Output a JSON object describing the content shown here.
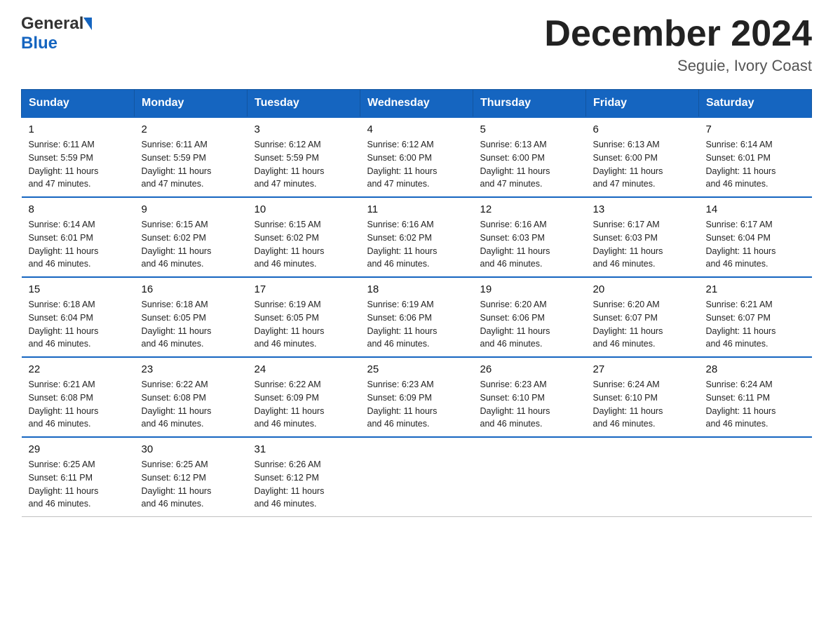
{
  "header": {
    "logo_line1": "General",
    "logo_line2": "Blue",
    "main_title": "December 2024",
    "subtitle": "Seguie, Ivory Coast"
  },
  "days_of_week": [
    "Sunday",
    "Monday",
    "Tuesday",
    "Wednesday",
    "Thursday",
    "Friday",
    "Saturday"
  ],
  "weeks": [
    [
      {
        "day": "1",
        "sunrise": "6:11 AM",
        "sunset": "5:59 PM",
        "daylight": "11 hours and 47 minutes."
      },
      {
        "day": "2",
        "sunrise": "6:11 AM",
        "sunset": "5:59 PM",
        "daylight": "11 hours and 47 minutes."
      },
      {
        "day": "3",
        "sunrise": "6:12 AM",
        "sunset": "5:59 PM",
        "daylight": "11 hours and 47 minutes."
      },
      {
        "day": "4",
        "sunrise": "6:12 AM",
        "sunset": "6:00 PM",
        "daylight": "11 hours and 47 minutes."
      },
      {
        "day": "5",
        "sunrise": "6:13 AM",
        "sunset": "6:00 PM",
        "daylight": "11 hours and 47 minutes."
      },
      {
        "day": "6",
        "sunrise": "6:13 AM",
        "sunset": "6:00 PM",
        "daylight": "11 hours and 47 minutes."
      },
      {
        "day": "7",
        "sunrise": "6:14 AM",
        "sunset": "6:01 PM",
        "daylight": "11 hours and 46 minutes."
      }
    ],
    [
      {
        "day": "8",
        "sunrise": "6:14 AM",
        "sunset": "6:01 PM",
        "daylight": "11 hours and 46 minutes."
      },
      {
        "day": "9",
        "sunrise": "6:15 AM",
        "sunset": "6:02 PM",
        "daylight": "11 hours and 46 minutes."
      },
      {
        "day": "10",
        "sunrise": "6:15 AM",
        "sunset": "6:02 PM",
        "daylight": "11 hours and 46 minutes."
      },
      {
        "day": "11",
        "sunrise": "6:16 AM",
        "sunset": "6:02 PM",
        "daylight": "11 hours and 46 minutes."
      },
      {
        "day": "12",
        "sunrise": "6:16 AM",
        "sunset": "6:03 PM",
        "daylight": "11 hours and 46 minutes."
      },
      {
        "day": "13",
        "sunrise": "6:17 AM",
        "sunset": "6:03 PM",
        "daylight": "11 hours and 46 minutes."
      },
      {
        "day": "14",
        "sunrise": "6:17 AM",
        "sunset": "6:04 PM",
        "daylight": "11 hours and 46 minutes."
      }
    ],
    [
      {
        "day": "15",
        "sunrise": "6:18 AM",
        "sunset": "6:04 PM",
        "daylight": "11 hours and 46 minutes."
      },
      {
        "day": "16",
        "sunrise": "6:18 AM",
        "sunset": "6:05 PM",
        "daylight": "11 hours and 46 minutes."
      },
      {
        "day": "17",
        "sunrise": "6:19 AM",
        "sunset": "6:05 PM",
        "daylight": "11 hours and 46 minutes."
      },
      {
        "day": "18",
        "sunrise": "6:19 AM",
        "sunset": "6:06 PM",
        "daylight": "11 hours and 46 minutes."
      },
      {
        "day": "19",
        "sunrise": "6:20 AM",
        "sunset": "6:06 PM",
        "daylight": "11 hours and 46 minutes."
      },
      {
        "day": "20",
        "sunrise": "6:20 AM",
        "sunset": "6:07 PM",
        "daylight": "11 hours and 46 minutes."
      },
      {
        "day": "21",
        "sunrise": "6:21 AM",
        "sunset": "6:07 PM",
        "daylight": "11 hours and 46 minutes."
      }
    ],
    [
      {
        "day": "22",
        "sunrise": "6:21 AM",
        "sunset": "6:08 PM",
        "daylight": "11 hours and 46 minutes."
      },
      {
        "day": "23",
        "sunrise": "6:22 AM",
        "sunset": "6:08 PM",
        "daylight": "11 hours and 46 minutes."
      },
      {
        "day": "24",
        "sunrise": "6:22 AM",
        "sunset": "6:09 PM",
        "daylight": "11 hours and 46 minutes."
      },
      {
        "day": "25",
        "sunrise": "6:23 AM",
        "sunset": "6:09 PM",
        "daylight": "11 hours and 46 minutes."
      },
      {
        "day": "26",
        "sunrise": "6:23 AM",
        "sunset": "6:10 PM",
        "daylight": "11 hours and 46 minutes."
      },
      {
        "day": "27",
        "sunrise": "6:24 AM",
        "sunset": "6:10 PM",
        "daylight": "11 hours and 46 minutes."
      },
      {
        "day": "28",
        "sunrise": "6:24 AM",
        "sunset": "6:11 PM",
        "daylight": "11 hours and 46 minutes."
      }
    ],
    [
      {
        "day": "29",
        "sunrise": "6:25 AM",
        "sunset": "6:11 PM",
        "daylight": "11 hours and 46 minutes."
      },
      {
        "day": "30",
        "sunrise": "6:25 AM",
        "sunset": "6:12 PM",
        "daylight": "11 hours and 46 minutes."
      },
      {
        "day": "31",
        "sunrise": "6:26 AM",
        "sunset": "6:12 PM",
        "daylight": "11 hours and 46 minutes."
      },
      null,
      null,
      null,
      null
    ]
  ],
  "labels": {
    "sunrise": "Sunrise:",
    "sunset": "Sunset:",
    "daylight": "Daylight:"
  }
}
